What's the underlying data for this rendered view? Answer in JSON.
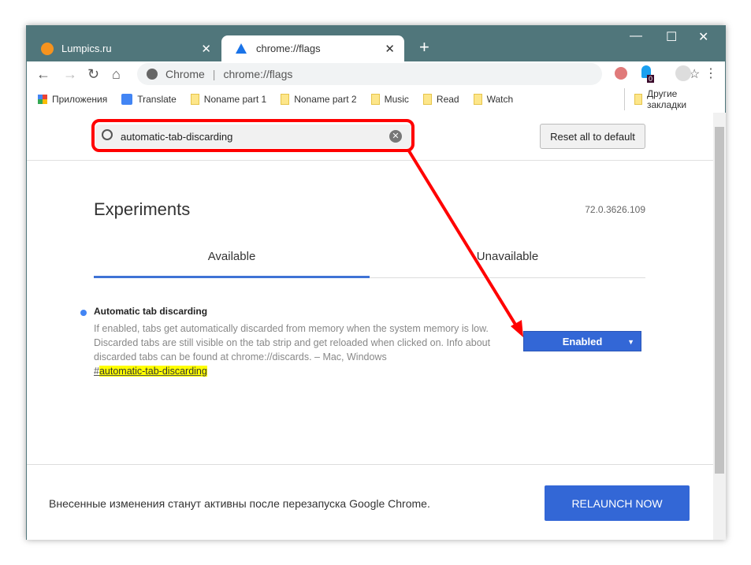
{
  "tabs": [
    {
      "title": "Lumpics.ru"
    },
    {
      "title": "chrome://flags"
    }
  ],
  "window": {
    "new_tab": "+",
    "minimize": "—",
    "maximize": "☐",
    "close": "✕"
  },
  "omnibox": {
    "site": "Chrome",
    "url": "chrome://flags"
  },
  "extensions": {
    "badge": "0"
  },
  "bookmarks": {
    "items": [
      "Приложения",
      "Translate",
      "Noname part 1",
      "Noname part 2",
      "Music",
      "Read",
      "Watch"
    ],
    "other": "Другие закладки"
  },
  "search": {
    "value": "automatic-tab-discarding"
  },
  "reset_label": "Reset all to default",
  "title": "Experiments",
  "version": "72.0.3626.109",
  "tab_available": "Available",
  "tab_unavailable": "Unavailable",
  "flag": {
    "name": "Automatic tab discarding",
    "description": "If enabled, tabs get automatically discarded from memory when the system memory is low. Discarded tabs are still visible on the tab strip and get reloaded when clicked on. Info about discarded tabs can be found at chrome://discards. – Mac, Windows",
    "hash": "#",
    "link": "automatic-tab-discarding",
    "value": "Enabled"
  },
  "footer": {
    "text": "Внесенные изменения станут активны после перезапуска Google Chrome.",
    "button": "RELAUNCH NOW"
  },
  "colors": {
    "frame": "#50767b",
    "accent": "#3367d6",
    "annotation": "#ff0000"
  }
}
